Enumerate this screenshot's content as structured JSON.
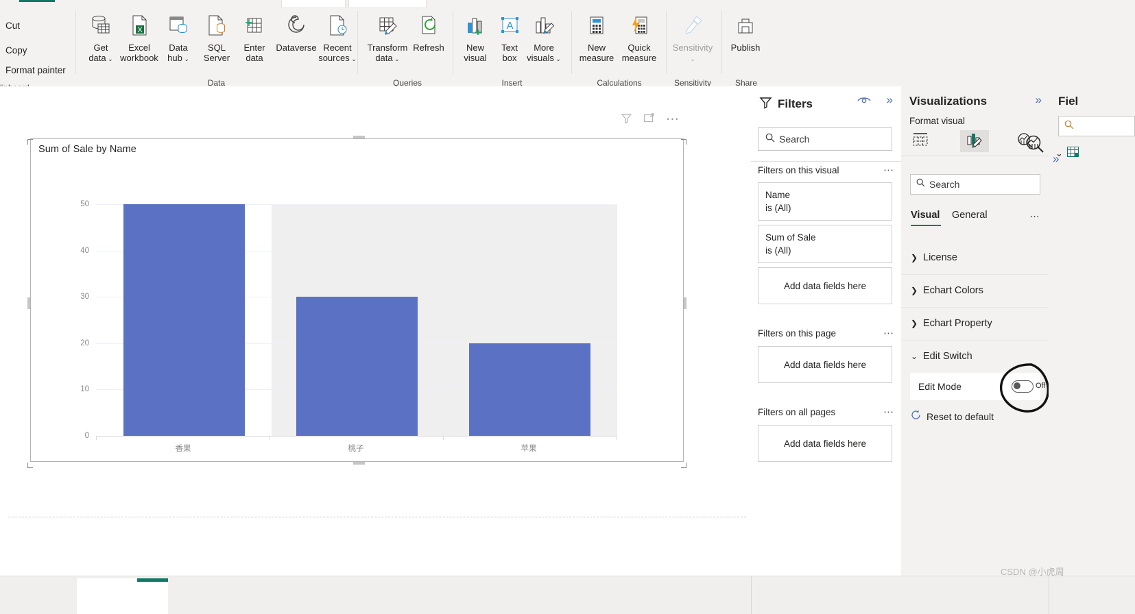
{
  "ribbon": {
    "clipboard": {
      "group_label": "lipboard",
      "items": [
        {
          "label": "Cut",
          "icon": "scissors-icon"
        },
        {
          "label": "Copy",
          "icon": "copy-icon"
        },
        {
          "label": "Format painter",
          "icon": "format-painter-icon"
        }
      ]
    },
    "groups": [
      {
        "name": "Data",
        "label": "Data",
        "buttons": [
          {
            "id": "get-data",
            "line1": "Get",
            "line2": "data",
            "caret": true,
            "icon": "database-table-icon",
            "disabled": false
          },
          {
            "id": "excel-workbook",
            "line1": "Excel",
            "line2": "workbook",
            "caret": false,
            "icon": "excel-file-icon",
            "disabled": false
          },
          {
            "id": "data-hub",
            "line1": "Data",
            "line2": "hub",
            "caret": true,
            "icon": "data-hub-icon",
            "disabled": false
          },
          {
            "id": "sql-server",
            "line1": "SQL",
            "line2": "Server",
            "caret": false,
            "icon": "sql-server-icon",
            "disabled": false
          },
          {
            "id": "enter-data",
            "line1": "Enter",
            "line2": "data",
            "caret": false,
            "icon": "enter-data-icon",
            "disabled": false
          },
          {
            "id": "dataverse",
            "line1": "Dataverse",
            "line2": "",
            "caret": false,
            "icon": "dataverse-icon",
            "disabled": false
          },
          {
            "id": "recent-sources",
            "line1": "Recent",
            "line2": "sources",
            "caret": true,
            "icon": "recent-sources-icon",
            "disabled": false
          }
        ]
      },
      {
        "name": "Queries",
        "label": "Queries",
        "buttons": [
          {
            "id": "transform-data",
            "line1": "Transform",
            "line2": "data",
            "caret": true,
            "icon": "transform-data-icon",
            "disabled": false
          },
          {
            "id": "refresh",
            "line1": "Refresh",
            "line2": "",
            "caret": false,
            "icon": "refresh-icon",
            "disabled": false
          }
        ]
      },
      {
        "name": "Insert",
        "label": "Insert",
        "buttons": [
          {
            "id": "new-visual",
            "line1": "New",
            "line2": "visual",
            "caret": false,
            "icon": "new-visual-icon",
            "disabled": false
          },
          {
            "id": "text-box",
            "line1": "Text",
            "line2": "box",
            "caret": false,
            "icon": "text-box-icon",
            "disabled": false
          },
          {
            "id": "more-visuals",
            "line1": "More",
            "line2": "visuals",
            "caret": true,
            "icon": "more-visuals-icon",
            "disabled": false
          }
        ]
      },
      {
        "name": "Calculations",
        "label": "Calculations",
        "buttons": [
          {
            "id": "new-measure",
            "line1": "New",
            "line2": "measure",
            "caret": false,
            "icon": "new-measure-icon",
            "disabled": false
          },
          {
            "id": "quick-measure",
            "line1": "Quick",
            "line2": "measure",
            "caret": false,
            "icon": "quick-measure-icon",
            "disabled": false
          }
        ]
      },
      {
        "name": "Sensitivity",
        "label": "Sensitivity",
        "buttons": [
          {
            "id": "sensitivity",
            "line1": "Sensitivity",
            "line2": "",
            "caret": true,
            "icon": "sensitivity-icon",
            "disabled": true
          }
        ]
      },
      {
        "name": "Share",
        "label": "Share",
        "buttons": [
          {
            "id": "publish",
            "line1": "Publish",
            "line2": "",
            "caret": false,
            "icon": "publish-icon",
            "disabled": false
          }
        ]
      }
    ]
  },
  "visual": {
    "title": "Sum of Sale by Name",
    "header_icons": [
      "filter-icon",
      "focus-mode-icon",
      "more-options-icon"
    ]
  },
  "chart_data": {
    "type": "bar",
    "title": "Sum of Sale by Name",
    "categories": [
      "香果",
      "桃子",
      "苹果"
    ],
    "values": [
      50,
      30,
      20
    ],
    "series": [
      {
        "name": "Sum of Sale",
        "values": [
          50,
          30,
          20
        ]
      }
    ],
    "xlabel": "",
    "ylabel": "",
    "ylim": [
      0,
      50
    ],
    "yticks": [
      0,
      10,
      20,
      30,
      40,
      50
    ],
    "ytick_labels": [
      "0",
      "10",
      "20",
      "30",
      "40",
      "50"
    ],
    "grid": true,
    "legend": "none",
    "bar_color": "#5b72c4",
    "band_stripe_color": "#efefef"
  },
  "filters": {
    "title": "Filters",
    "search_placeholder": "Search",
    "eye_icon": "eye-icon",
    "expand_icon": "chevron-double-right-icon",
    "sections": [
      {
        "label": "Filters on this visual",
        "cards": [
          {
            "name": "Name",
            "value": "is (All)"
          },
          {
            "name": "Sum of Sale",
            "value": "is (All)"
          }
        ],
        "dropzone": "Add data fields here"
      },
      {
        "label": "Filters on this page",
        "cards": [],
        "dropzone": "Add data fields here"
      },
      {
        "label": "Filters on all pages",
        "cards": [],
        "dropzone": "Add data fields here"
      }
    ]
  },
  "visualizations": {
    "title": "Visualizations",
    "subtitle": "Format visual",
    "expand_icon": "chevron-double-right-icon",
    "format_tabs": [
      {
        "id": "build-visual",
        "icon": "build-visual-icon",
        "active": false
      },
      {
        "id": "format-visual",
        "icon": "format-paint-icon",
        "active": true
      },
      {
        "id": "analytics",
        "icon": "analytics-magnifier-icon",
        "active": false
      }
    ],
    "search_placeholder": "Search",
    "tabs": [
      {
        "label": "Visual",
        "selected": true
      },
      {
        "label": "General",
        "selected": false
      }
    ],
    "tab_overflow": "…",
    "accordions": [
      {
        "label": "License",
        "expanded": false
      },
      {
        "label": "Echart Colors",
        "expanded": false
      },
      {
        "label": "Echart Property",
        "expanded": false
      },
      {
        "label": "Edit Switch",
        "expanded": true
      }
    ],
    "edit_switch": {
      "label": "Edit Mode",
      "toggle_state": "Off",
      "reset_label": "Reset to default",
      "reset_icon": "reset-icon"
    }
  },
  "fields": {
    "title": "Fiel",
    "search_icon": "search-icon",
    "expand_icon": "chevron-double-right-icon"
  },
  "watermark": "CSDN @小虎周"
}
